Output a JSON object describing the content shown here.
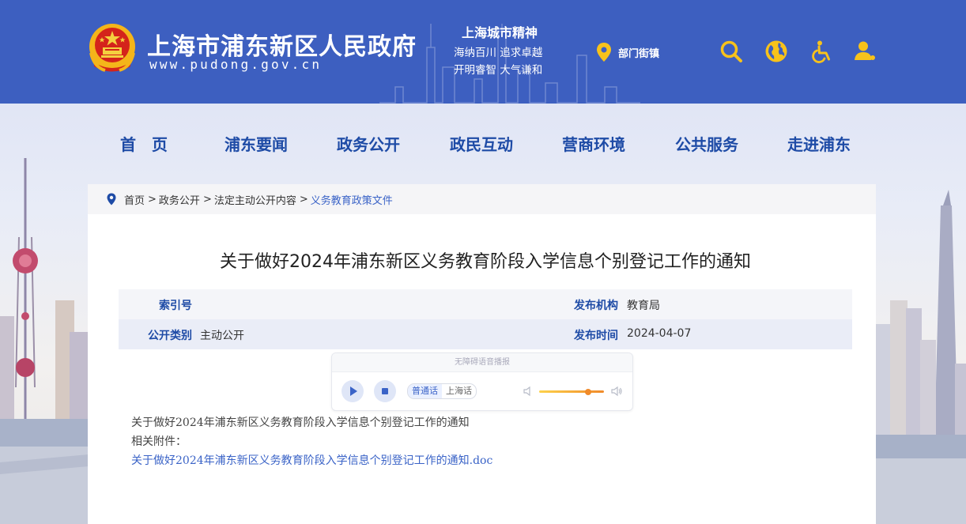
{
  "header": {
    "site_title": "上海市浦东新区人民政府",
    "site_url": "www.pudong.gov.cn",
    "spirit_title": "上海城市精神",
    "spirit_line1": "海纳百川  追求卓越",
    "spirit_line2": "开明睿智  大气谦和",
    "dept_label": "部门街镇",
    "icons": [
      "search-icon",
      "globe-icon",
      "accessibility-icon",
      "user-icon"
    ],
    "brand_color": "#3d5fc0"
  },
  "nav": {
    "items": [
      "首　页",
      "浦东要闻",
      "政务公开",
      "政民互动",
      "营商环境",
      "公共服务",
      "走进浦东"
    ],
    "color": "#1e4ba6"
  },
  "breadcrumb": {
    "items": [
      "首页",
      "政务公开",
      "法定主动公开内容"
    ],
    "separator": ">",
    "current": "义务教育政策文件"
  },
  "article": {
    "title": "关于做好2024年浦东新区义务教育阶段入学信息个别登记工作的通知",
    "meta": {
      "index_label": "索引号",
      "index_value": "",
      "publisher_label": "发布机构",
      "publisher_value": "教育局",
      "category_label": "公开类别",
      "category_value": "主动公开",
      "date_label": "发布时间",
      "date_value": "2024-04-07"
    },
    "player": {
      "heading": "无障碍语音播报",
      "dialect_mandarin": "普通话",
      "dialect_shanghai": "上海话",
      "selected_dialect": "普通话",
      "volume": 0.75
    },
    "body_line": "关于做好2024年浦东新区义务教育阶段入学信息个别登记工作的通知",
    "attachments_label": "相关附件：",
    "attachment": "关于做好2024年浦东新区义务教育阶段入学信息个别登记工作的通知.doc"
  }
}
